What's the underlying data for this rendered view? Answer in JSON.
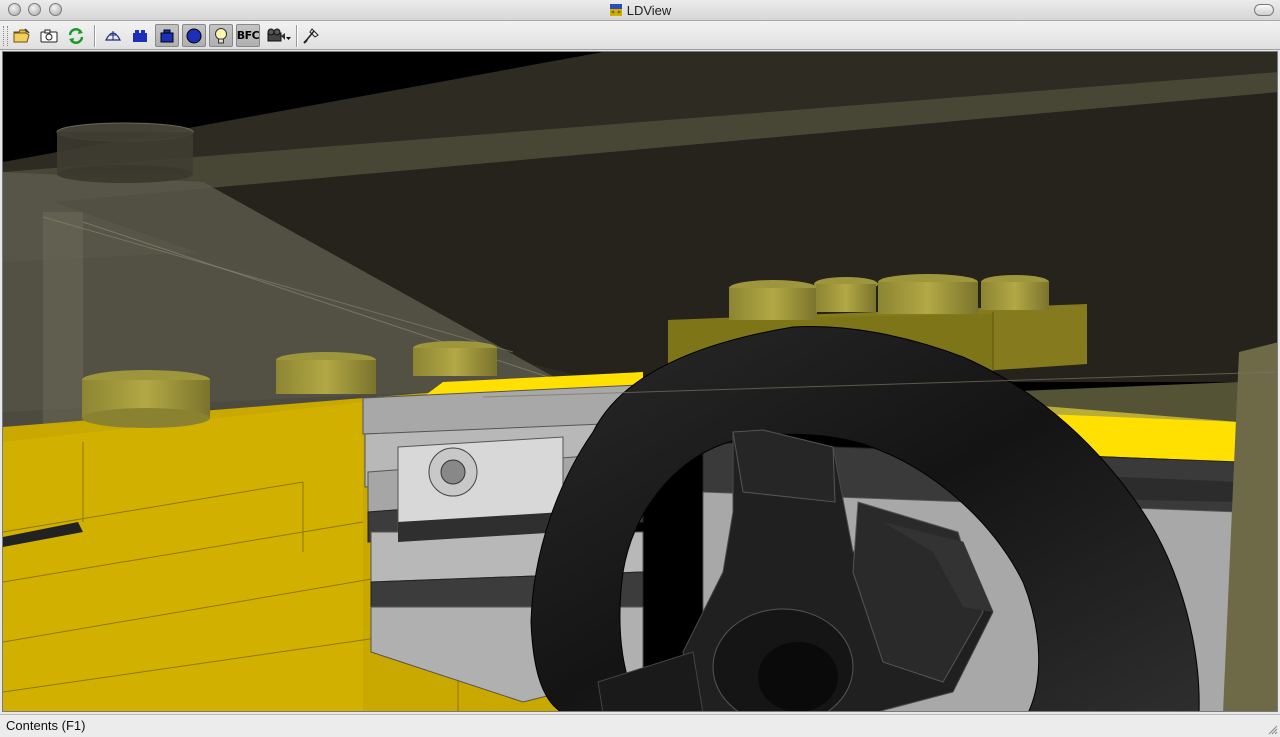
{
  "window": {
    "title": "LDView"
  },
  "toolbar": {
    "buttons": [
      {
        "id": "open",
        "icon": "open-folder-icon",
        "tooltip": "Open"
      },
      {
        "id": "snapshot",
        "icon": "camera-icon",
        "tooltip": "Save Snapshot"
      },
      {
        "id": "reload",
        "icon": "reload-icon",
        "tooltip": "Reload"
      },
      {
        "id": "wireframe",
        "icon": "wireframe-icon",
        "tooltip": "Wireframe"
      },
      {
        "id": "seams",
        "icon": "seams-icon",
        "tooltip": "Seams"
      },
      {
        "id": "edges",
        "icon": "edge-lines-icon",
        "tooltip": "Edge Lines"
      },
      {
        "id": "primitive",
        "icon": "primitive-substitution-icon",
        "tooltip": "Primitive Substitution"
      },
      {
        "id": "lighting",
        "icon": "lightbulb-icon",
        "tooltip": "Lighting"
      },
      {
        "id": "bfc",
        "icon": "bfc-icon",
        "label": "BFC"
      },
      {
        "id": "viewangle",
        "icon": "view-angle-icon",
        "tooltip": "View Angle"
      },
      {
        "id": "prefs",
        "icon": "preferences-icon",
        "tooltip": "Preferences"
      }
    ],
    "toggled": [
      "edges",
      "primitive",
      "lighting",
      "bfc"
    ]
  },
  "status": {
    "text": "Contents (F1)"
  },
  "colors": {
    "yellow_brick": "#cfad00",
    "trans_glass": "#6e6b58",
    "steering_wheel": "#1c1c1c",
    "gray_part": "#a8a8a8",
    "background": "#000000"
  }
}
